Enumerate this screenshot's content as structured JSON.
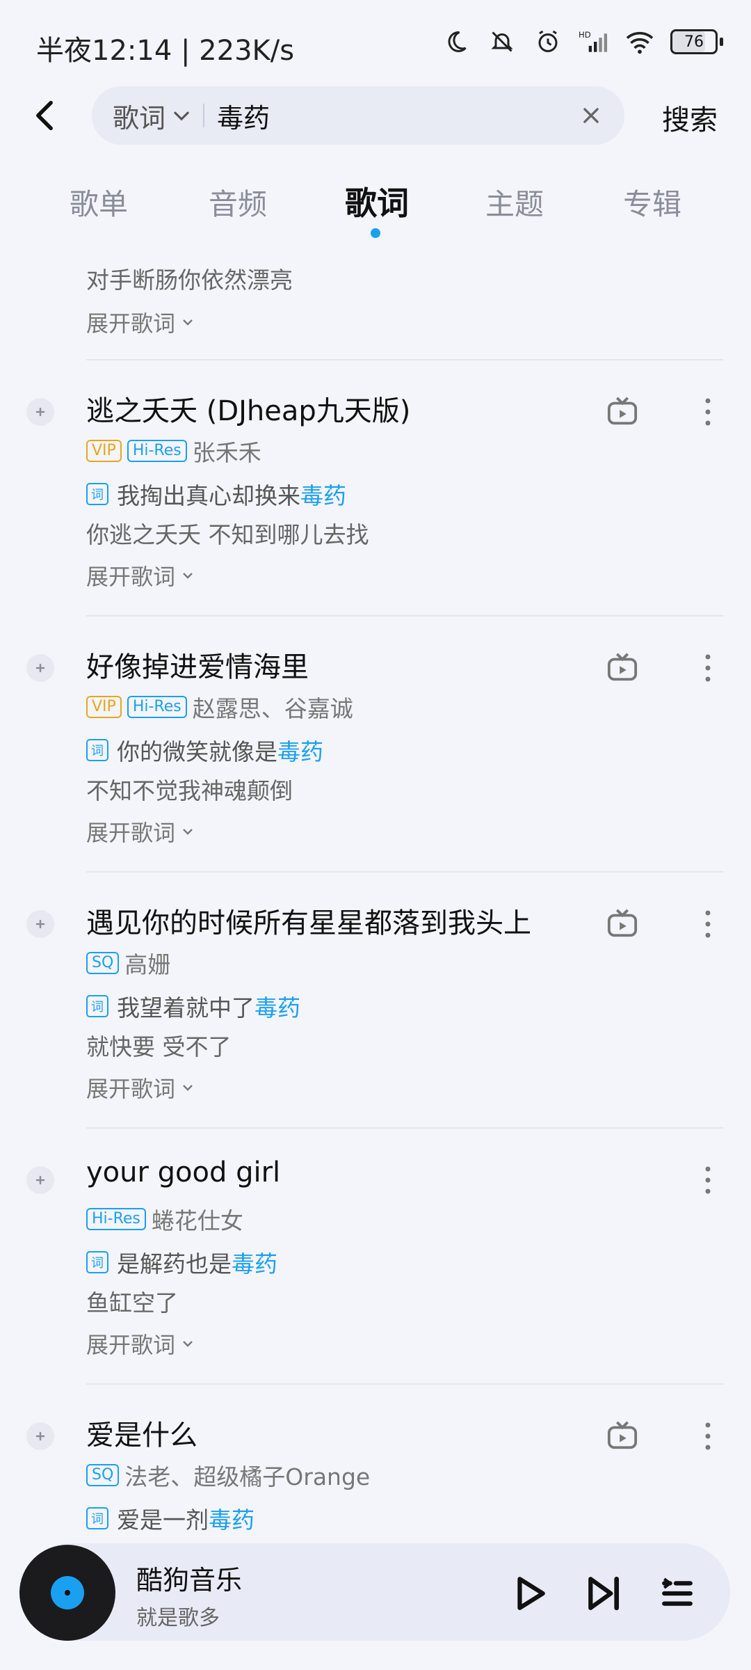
{
  "status": {
    "time": "半夜12:14 | 223K/s",
    "battery": "76"
  },
  "search": {
    "type_label": "歌词",
    "query": "毒药",
    "search_button": "搜索"
  },
  "tabs": [
    {
      "label": "歌单"
    },
    {
      "label": "音频"
    },
    {
      "label": "歌词",
      "active": true
    },
    {
      "label": "主题"
    },
    {
      "label": "专辑"
    }
  ],
  "partial_item": {
    "lyric_line2": "对手断肠你依然漂亮",
    "expand_label": "展开歌词"
  },
  "songs": [
    {
      "title": "逃之夭夭 (DJheap九天版)",
      "badges": [
        "VIP",
        "Hi-Res"
      ],
      "artist": "张禾禾",
      "lyric_prefix": "我掏出真心却换来",
      "lyric_highlight": "毒药",
      "lyric_line2": "你逃之夭夭 不知到哪儿去找",
      "expand_label": "展开歌词"
    },
    {
      "title": "好像掉进爱情海里",
      "badges": [
        "VIP",
        "Hi-Res"
      ],
      "artist": "赵露思、谷嘉诚",
      "lyric_prefix": "你的微笑就像是",
      "lyric_highlight": "毒药",
      "lyric_line2": "不知不觉我神魂颠倒",
      "expand_label": "展开歌词"
    },
    {
      "title": "遇见你的时候所有星星都落到我头上",
      "badges": [
        "SQ"
      ],
      "artist": "高姗",
      "lyric_prefix": "我望着就中了",
      "lyric_highlight": "毒药",
      "lyric_line2": "就快要 受不了",
      "expand_label": "展开歌词"
    },
    {
      "title": "your good girl",
      "badges": [
        "Hi-Res"
      ],
      "artist": "蜷花仕女",
      "lyric_prefix": "是解药也是",
      "lyric_highlight": "毒药",
      "lyric_line2": "鱼缸空了",
      "expand_label": "展开歌词"
    },
    {
      "title": "爱是什么",
      "badges": [
        "SQ"
      ],
      "artist": "法老、超级橘子Orange",
      "lyric_prefix": "爱是一剂",
      "lyric_highlight": "毒药"
    }
  ],
  "lyric_badge": "词",
  "player": {
    "title": "酷狗音乐",
    "subtitle": "就是歌多"
  },
  "colors": {
    "accent": "#1aa0f0",
    "vip": "#e7a61e",
    "background": "#f4f5fb"
  }
}
